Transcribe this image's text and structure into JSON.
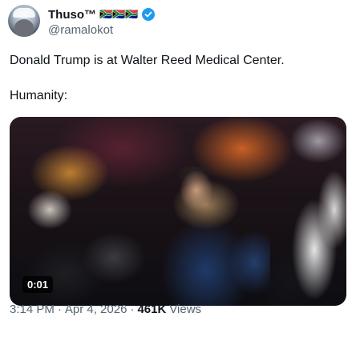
{
  "author": {
    "display_name": "Thuso™",
    "flags": "🇿🇦🇿🇦🇿🇦",
    "handle": "@ramalokot",
    "verified_icon": "verified-badge-icon",
    "avatar_icon": "avatar-photo"
  },
  "tweet": {
    "line1": "Donald Trump is at Walter Reed Medical Center.",
    "line2": "Humanity:"
  },
  "media": {
    "timestamp": "0:01"
  },
  "meta": {
    "time": "3:14 PM",
    "separator1": "·",
    "date": "Apr 4, 2026",
    "separator2": "·",
    "views_count": "461K",
    "views_label": "Views"
  },
  "colors": {
    "verified": "#1d9bf0",
    "secondary_text": "#536471",
    "primary_text": "#0f1419"
  }
}
